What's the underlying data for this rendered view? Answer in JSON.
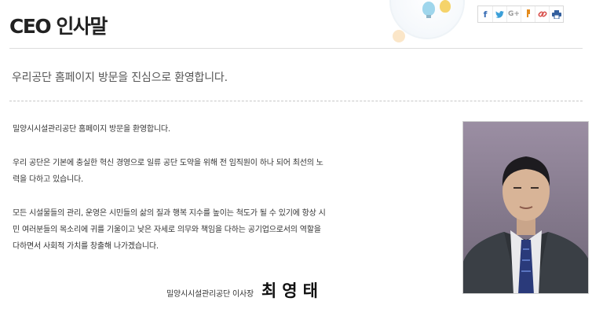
{
  "page": {
    "title": "CEO 인사말",
    "welcome": "우리공단 홈페이지 방문을 진심으로 환영합니다."
  },
  "share": {
    "items": [
      {
        "icon": "facebook-icon",
        "glyph": "f",
        "color": "#3b6fb6"
      },
      {
        "icon": "twitter-icon",
        "glyph": "y",
        "color": "#3b9fd8"
      },
      {
        "icon": "google-plus-icon",
        "glyph": "G+",
        "color": "#9a9a9a"
      },
      {
        "icon": "kakao-story-icon",
        "glyph": "❜",
        "color": "#e48b1c"
      },
      {
        "icon": "link-icon",
        "glyph": "%",
        "color": "#d9534f"
      },
      {
        "icon": "print-icon",
        "glyph": "⎙",
        "color": "#34609e"
      }
    ]
  },
  "message": {
    "p1": "밀양시시설관리공단 홈페이지 방문을 환영합니다.",
    "p2_l1": "우리 공단은 기본에 충실한 혁신 경영으로 일류 공단 도약을 위해 전 임직원이 하나 되어 최선의 노",
    "p2_l2": "력을 다하고 있습니다.",
    "p3_l1": "모든 시설물들의 관리, 운영은 시민들의 삶의 질과 행복 지수를 높이는 척도가 될 수 있기에 항상 시",
    "p3_l2": "민 여러분들의 목소리에 귀를 기울이고 낮은 자세로 의무와 책임을 다하는 공기업으로서의 역할을",
    "p3_l3": "다하면서 사회적 가치를 창출해 나가겠습니다."
  },
  "signature": {
    "org": "밀양시시설관리공단 이사장",
    "name": "최영태"
  },
  "colors": {
    "title": "#222222",
    "divider": "#dcdcdc",
    "portrait_background": "#8a7f92"
  }
}
